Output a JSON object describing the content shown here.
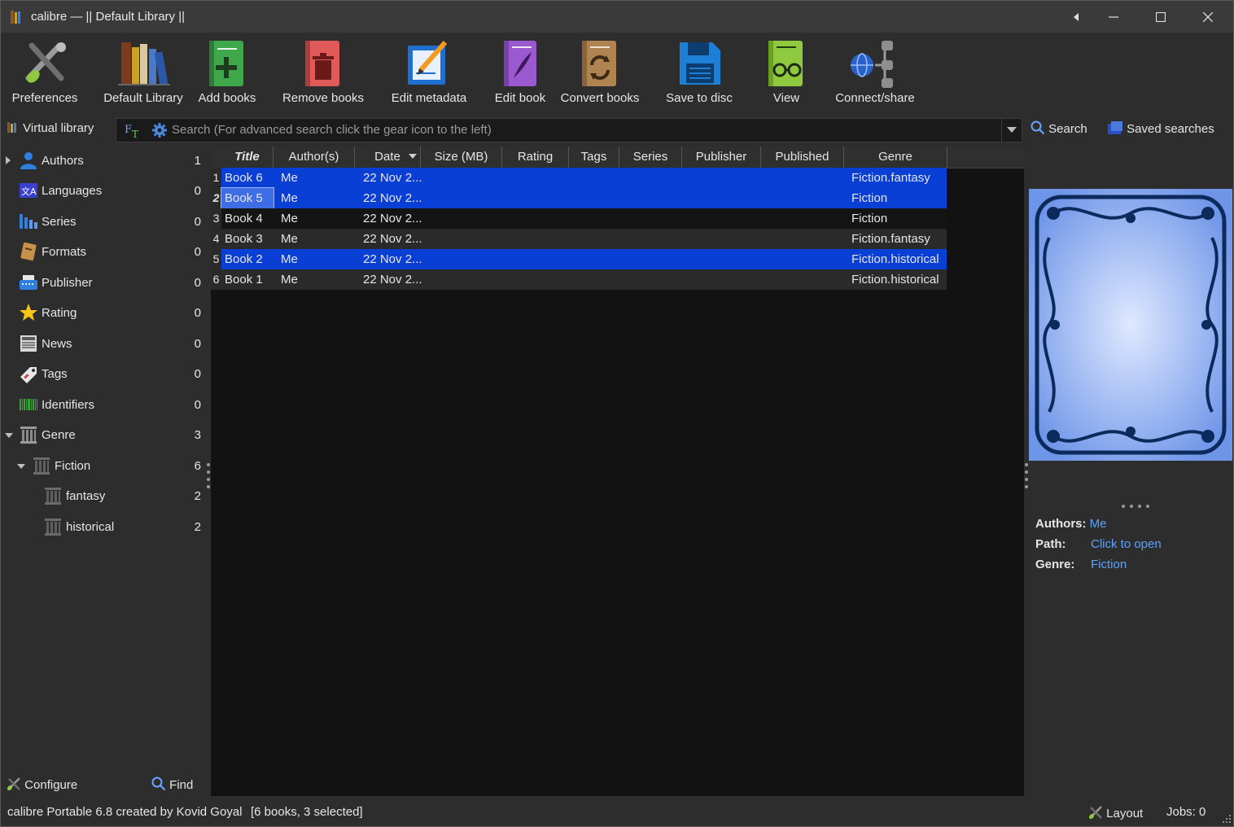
{
  "window": {
    "title": "calibre — || Default Library ||"
  },
  "toolbar": {
    "preferences": "Preferences",
    "library": "Default Library",
    "add_books": "Add books",
    "remove_books": "Remove books",
    "edit_metadata": "Edit metadata",
    "edit_book": "Edit book",
    "convert_books": "Convert books",
    "save_to_disc": "Save to disc",
    "view": "View",
    "connect_share": "Connect/share"
  },
  "searchbar": {
    "virtual_library": "Virtual library",
    "placeholder": "Search (For advanced search click the gear icon to the left)",
    "search_button": "Search",
    "saved_searches": "Saved searches"
  },
  "tag_browser": {
    "items": [
      {
        "name": "Authors",
        "count": "1"
      },
      {
        "name": "Languages",
        "count": "0"
      },
      {
        "name": "Series",
        "count": "0"
      },
      {
        "name": "Formats",
        "count": "0"
      },
      {
        "name": "Publisher",
        "count": "0"
      },
      {
        "name": "Rating",
        "count": "0"
      },
      {
        "name": "News",
        "count": "0"
      },
      {
        "name": "Tags",
        "count": "0"
      },
      {
        "name": "Identifiers",
        "count": "0"
      },
      {
        "name": "Genre",
        "count": "3"
      },
      {
        "name": "Fiction",
        "count": "6"
      },
      {
        "name": "fantasy",
        "count": "2"
      },
      {
        "name": "historical",
        "count": "2"
      }
    ],
    "configure": "Configure",
    "find": "Find"
  },
  "book_list": {
    "columns": [
      "Title",
      "Author(s)",
      "Date",
      "Size (MB)",
      "Rating",
      "Tags",
      "Series",
      "Publisher",
      "Published",
      "Genre"
    ],
    "rows": [
      {
        "num": "1",
        "title": "Book 6",
        "author": "Me",
        "date": "22 Nov 2...",
        "genre": "Fiction.fantasy",
        "selected": true
      },
      {
        "num": "2",
        "title": "Book 5",
        "author": "Me",
        "date": "22 Nov 2...",
        "genre": "Fiction",
        "selected": true,
        "current": true
      },
      {
        "num": "3",
        "title": "Book 4",
        "author": "Me",
        "date": "22 Nov 2...",
        "genre": "Fiction",
        "selected": false
      },
      {
        "num": "4",
        "title": "Book 3",
        "author": "Me",
        "date": "22 Nov 2...",
        "genre": "Fiction.fantasy",
        "selected": false
      },
      {
        "num": "5",
        "title": "Book 2",
        "author": "Me",
        "date": "22 Nov 2...",
        "genre": "Fiction.historical",
        "selected": true
      },
      {
        "num": "6",
        "title": "Book 1",
        "author": "Me",
        "date": "22 Nov 2...",
        "genre": "Fiction.historical",
        "selected": false
      }
    ]
  },
  "details": {
    "authors_label": "Authors:",
    "authors_value": "Me",
    "path_label": "Path:",
    "path_value": "Click to open",
    "genre_label": "Genre:",
    "genre_value": "Fiction"
  },
  "statusbar": {
    "left": "calibre Portable 6.8 created by Kovid Goyal",
    "count": "[6 books, 3 selected]",
    "layout": "Layout",
    "jobs": "Jobs: 0"
  },
  "colors": {
    "selection": "#0a3fd6",
    "current_cell": "#3f6de6",
    "link": "#5ba3ff"
  }
}
